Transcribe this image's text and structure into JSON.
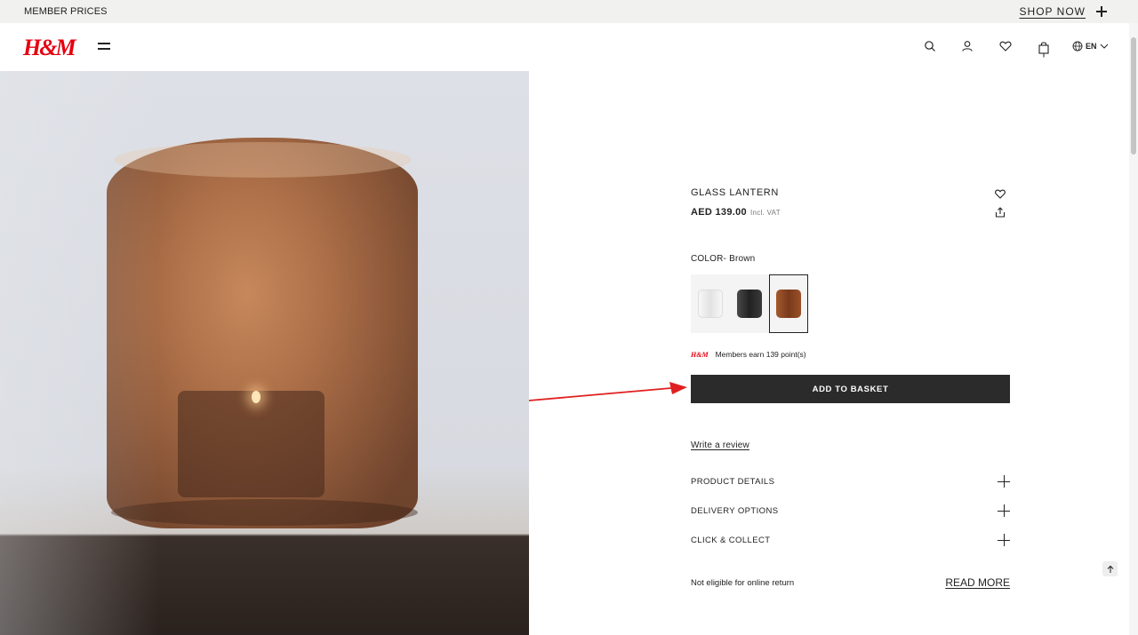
{
  "banner": {
    "text": "MEMBER PRICES",
    "cta": "SHOP NOW"
  },
  "header": {
    "logo": "H&M",
    "language": "EN",
    "icons": [
      "search-icon",
      "account-icon",
      "heart-icon",
      "bag-icon",
      "globe-icon"
    ]
  },
  "product": {
    "title": "GLASS LANTERN",
    "price": "AED 139.00",
    "vat": "Incl. VAT",
    "color_label": "COLOR- Brown",
    "swatches": [
      {
        "name": "Clear",
        "color": "#e9e9e9"
      },
      {
        "name": "Black",
        "color": "#2e2e2e"
      },
      {
        "name": "Brown",
        "color": "#8a4a26",
        "selected": true
      }
    ],
    "members_text": "Members earn 139 point(s)",
    "add_to_basket": "ADD TO BASKET",
    "write_review": "Write a review",
    "accordions": [
      "PRODUCT DETAILS",
      "DELIVERY OPTIONS",
      "CLICK & COLLECT"
    ],
    "return_text": "Not eligible for online return",
    "read_more": "READ MORE"
  },
  "colors": {
    "brand_red": "#e50010",
    "button_dark": "#2b2b2b",
    "banner_bg": "#f1f1ef",
    "annotation_arrow": "#e02020"
  }
}
